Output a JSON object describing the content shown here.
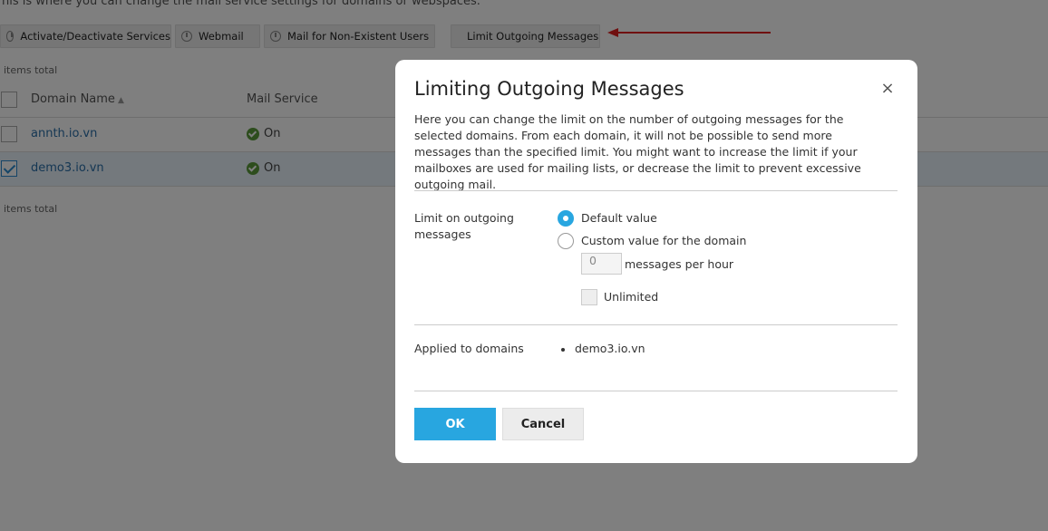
{
  "page": {
    "intro_text": "his is where you can change the mail service settings for domains or webspaces.",
    "toolbar": {
      "activate_label": "Activate/Deactivate Services",
      "webmail_label": "Webmail",
      "nonexistent_label": "Mail for Non-Existent Users",
      "limit_label": "Limit Outgoing Messages"
    },
    "items_total_top": "items total",
    "items_total_bottom": "items total",
    "table": {
      "col_domain": "Domain Name",
      "col_mail": "Mail Service",
      "sort_icon": "▲",
      "rows": [
        {
          "domain": "annth.io.vn",
          "status": "On",
          "checked": false
        },
        {
          "domain": "demo3.io.vn",
          "status": "On",
          "checked": true
        }
      ]
    },
    "annotation": {
      "arrow_color": "#e02020"
    }
  },
  "dialog": {
    "title": "Limiting Outgoing Messages",
    "close_glyph": "×",
    "description": "Here you can change the limit on the number of outgoing messages for the selected domains. From each domain, it will not be possible to send more messages than the specified limit. You might want to increase the limit if your mailboxes are used for mailing lists, or decrease the limit to prevent excessive outgoing mail.",
    "limit_label": "Limit on outgoing messages",
    "option_default": "Default value",
    "option_custom": "Custom value for the domain",
    "selected_option": "Default value",
    "custom_value": "0",
    "unit_label": "messages per hour",
    "unlimited_label": "Unlimited",
    "unlimited_checked": false,
    "applied_label": "Applied to domains",
    "applied_domains": [
      "demo3.io.vn"
    ],
    "ok_label": "OK",
    "cancel_label": "Cancel",
    "accent_color": "#28a6e0"
  }
}
